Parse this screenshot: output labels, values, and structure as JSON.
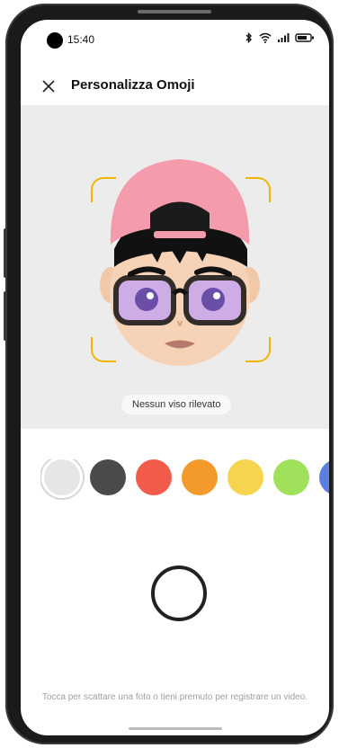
{
  "status_bar": {
    "time": "15:40"
  },
  "header": {
    "title": "Personalizza Omoji"
  },
  "preview": {
    "toast": "Nessun viso rilevato"
  },
  "swatches": [
    {
      "name": "white",
      "color": "#e6e6e6",
      "selected": true
    },
    {
      "name": "dark-gray",
      "color": "#4a4a4a"
    },
    {
      "name": "red",
      "color": "#f25b4a"
    },
    {
      "name": "orange",
      "color": "#f39a2b"
    },
    {
      "name": "yellow",
      "color": "#f6d44f"
    },
    {
      "name": "green",
      "color": "#9fe15b"
    },
    {
      "name": "blue",
      "color": "#5a7fe0"
    }
  ],
  "hint": "Tocca per scattare una foto o tieni premuto per registrare un video."
}
